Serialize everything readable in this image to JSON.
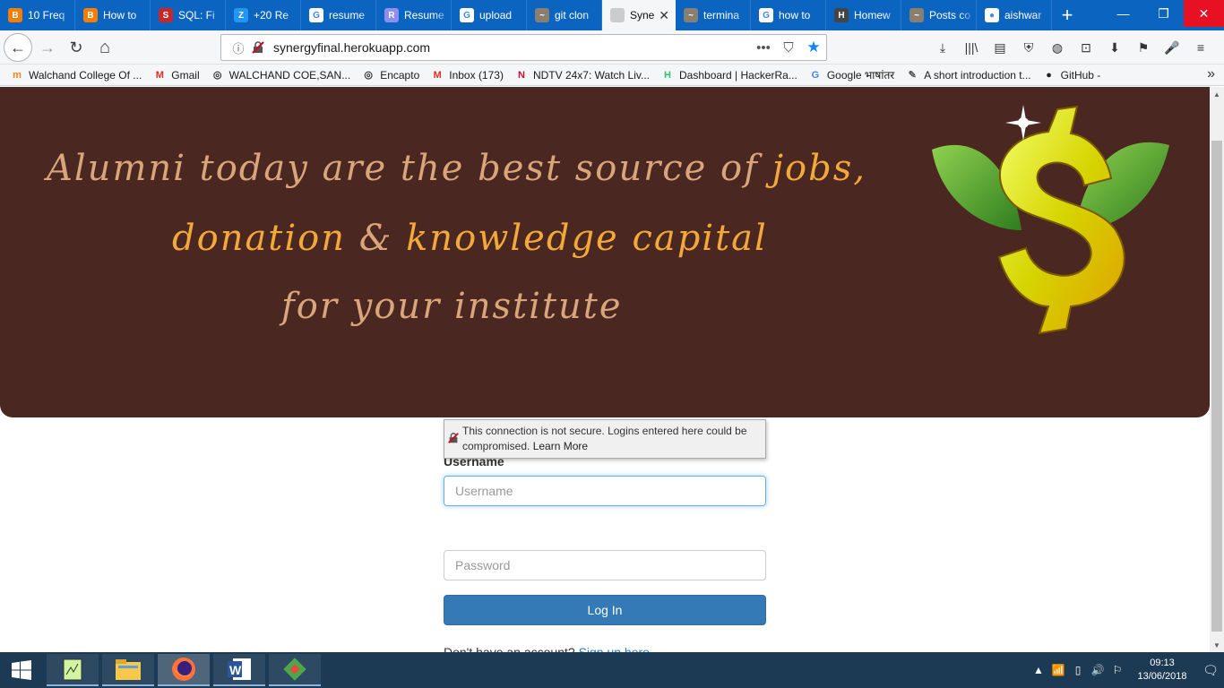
{
  "tabs": [
    {
      "label": "10 Freq",
      "icon": "blogger-icon",
      "color": "#f57d00",
      "glyph": "B"
    },
    {
      "label": "How to",
      "icon": "blogger-icon",
      "color": "#f57d00",
      "glyph": "B"
    },
    {
      "label": "SQL: Fi",
      "icon": "site-icon",
      "color": "#c62828",
      "glyph": "S"
    },
    {
      "label": "+20 Re",
      "icon": "zety-icon",
      "color": "#2196f3",
      "glyph": "Z"
    },
    {
      "label": "resume",
      "icon": "google-icon",
      "color": "#ffffff",
      "glyph": "G"
    },
    {
      "label": "Resume",
      "icon": "resume-icon",
      "color": "#8e8ef0",
      "glyph": "R"
    },
    {
      "label": "upload",
      "icon": "google-icon",
      "color": "#ffffff",
      "glyph": "G"
    },
    {
      "label": "git clon",
      "icon": "page-icon",
      "color": "#8a7f6f",
      "glyph": "~"
    },
    {
      "label": "Synergy",
      "icon": "page-icon",
      "color": "#cccccc",
      "glyph": "",
      "active": true
    },
    {
      "label": "termina",
      "icon": "page-icon",
      "color": "#8a7f6f",
      "glyph": "~"
    },
    {
      "label": "how to",
      "icon": "google-icon",
      "color": "#ffffff",
      "glyph": "G"
    },
    {
      "label": "Homew",
      "icon": "home-icon",
      "color": "#444444",
      "glyph": "H"
    },
    {
      "label": "Posts co",
      "icon": "page-icon",
      "color": "#8a7f6f",
      "glyph": "~"
    },
    {
      "label": "aishwar",
      "icon": "github-icon",
      "color": "#ffffff",
      "glyph": "●"
    }
  ],
  "close_tab": "✕",
  "new_tab": "+",
  "window": {
    "minimize": "—",
    "maximize": "❐",
    "close": "✕"
  },
  "nav": {
    "url": "synergyfinal.herokuapp.com",
    "back": "←",
    "forward": "→",
    "reload": "↻",
    "home": "⌂",
    "more": "•••",
    "pocket": "⛉",
    "star": "★"
  },
  "toolbar_icons": [
    "⤓",
    "|||\\",
    "▤",
    "⛨",
    "◍",
    "⊡",
    "⬇",
    "⚑",
    "🎤",
    "≡"
  ],
  "bookmarks": [
    {
      "label": "Walchand College Of ...",
      "icon": "moodle-icon",
      "glyph": "m",
      "color": "#f98012"
    },
    {
      "label": "Gmail",
      "icon": "gmail-icon",
      "glyph": "M",
      "color": "#d93025"
    },
    {
      "label": "WALCHAND COE,SAN...",
      "icon": "globe-icon",
      "glyph": "◎",
      "color": "#333333"
    },
    {
      "label": "Encapto",
      "icon": "globe-icon",
      "glyph": "◎",
      "color": "#333333"
    },
    {
      "label": "Inbox (173)",
      "icon": "gmail-icon",
      "glyph": "M",
      "color": "#d93025"
    },
    {
      "label": "NDTV 24x7: Watch Liv...",
      "icon": "ndtv-icon",
      "glyph": "N",
      "color": "#c8102e"
    },
    {
      "label": "Dashboard | HackerRa...",
      "icon": "hackerrank-icon",
      "glyph": "H",
      "color": "#2ec866"
    },
    {
      "label": "Google भाषांतर",
      "icon": "translate-icon",
      "glyph": "G",
      "color": "#4285f4"
    },
    {
      "label": "A short introduction t...",
      "icon": "book-icon",
      "glyph": "✎",
      "color": "#555555"
    },
    {
      "label": "GitHub -",
      "icon": "github-icon",
      "glyph": "●",
      "color": "#222222"
    }
  ],
  "bookmarks_more": "»",
  "hero": {
    "line1_a": "Alumni today are the best source of ",
    "line1_b": "jobs,",
    "line2_a": "donation",
    "line2_b": " & ",
    "line2_c": "knowledge capital",
    "line3": "for your institute"
  },
  "carousel": {
    "count": 4,
    "active_index": 3
  },
  "form": {
    "username_label": "Username",
    "username_placeholder": "Username",
    "insecure_message": "This connection is not secure. Logins entered here could be compromised.",
    "learn_more": "Learn More",
    "password_placeholder": "Password",
    "login_button": "Log In",
    "signup_prompt": "Don't have an account?",
    "signup_link": "Sign up here."
  },
  "taskbar": {
    "time": "09:13",
    "date": "13/06/2018",
    "tray_icons": [
      "▲",
      "📶",
      "▯",
      "🔊",
      "⚐"
    ],
    "notification": "🗨"
  },
  "colors": {
    "tabstrip": "#0b64c0",
    "hero_bg": "#4a2720",
    "primary_button": "#337ab7",
    "link": "#337ab7"
  }
}
